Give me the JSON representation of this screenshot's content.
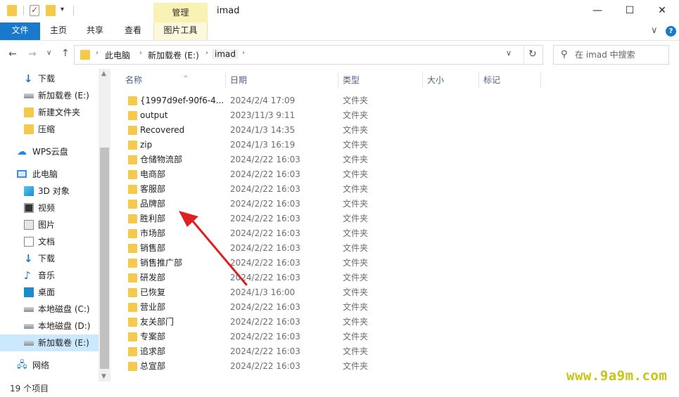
{
  "titlebar": {
    "manage_tab": "管理",
    "window_title": "imad",
    "minimize": "—",
    "maximize": "☐",
    "close": "✕"
  },
  "ribbon": {
    "tabs": [
      "文件",
      "主页",
      "共享",
      "查看",
      "图片工具"
    ],
    "expand": "∨",
    "help": "?"
  },
  "address": {
    "crumbs": [
      "此电脑",
      "新加载卷 (E:)",
      "imad"
    ],
    "search_placeholder": "在 imad 中搜索"
  },
  "sidebar": {
    "items": [
      {
        "label": "下载",
        "icon": "download-icon"
      },
      {
        "label": "新加载卷 (E:)",
        "icon": "drive-icon"
      },
      {
        "label": "新建文件夹",
        "icon": "folder-icon"
      },
      {
        "label": "压缩",
        "icon": "folder-icon"
      },
      {
        "label": "WPS云盘",
        "icon": "cloud-icon"
      },
      {
        "label": "此电脑",
        "icon": "computer-icon"
      },
      {
        "label": "3D 对象",
        "icon": "3d-objects-icon"
      },
      {
        "label": "视频",
        "icon": "video-icon"
      },
      {
        "label": "图片",
        "icon": "picture-icon"
      },
      {
        "label": "文档",
        "icon": "document-icon"
      },
      {
        "label": "下载",
        "icon": "download-icon"
      },
      {
        "label": "音乐",
        "icon": "music-icon"
      },
      {
        "label": "桌面",
        "icon": "desktop-icon"
      },
      {
        "label": "本地磁盘 (C:)",
        "icon": "system-drive-icon"
      },
      {
        "label": "本地磁盘 (D:)",
        "icon": "drive-icon"
      },
      {
        "label": "新加载卷 (E:)",
        "icon": "drive-icon"
      },
      {
        "label": "网络",
        "icon": "network-icon"
      }
    ]
  },
  "columns": {
    "name": "名称",
    "date": "日期",
    "type": "类型",
    "size": "大小",
    "tags": "标记"
  },
  "files": [
    {
      "name": "{1997d9ef-90f6-4...",
      "date": "2024/2/4 17:09",
      "type": "文件夹"
    },
    {
      "name": "output",
      "date": "2023/11/3 9:11",
      "type": "文件夹"
    },
    {
      "name": "Recovered",
      "date": "2024/1/3 14:35",
      "type": "文件夹"
    },
    {
      "name": "zip",
      "date": "2024/1/3 16:19",
      "type": "文件夹"
    },
    {
      "name": "仓储物流部",
      "date": "2024/2/22 16:03",
      "type": "文件夹"
    },
    {
      "name": "电商部",
      "date": "2024/2/22 16:03",
      "type": "文件夹"
    },
    {
      "name": "客服部",
      "date": "2024/2/22 16:03",
      "type": "文件夹"
    },
    {
      "name": "品牌部",
      "date": "2024/2/22 16:03",
      "type": "文件夹"
    },
    {
      "name": "胜利部",
      "date": "2024/2/22 16:03",
      "type": "文件夹"
    },
    {
      "name": "市场部",
      "date": "2024/2/22 16:03",
      "type": "文件夹"
    },
    {
      "name": "销售部",
      "date": "2024/2/22 16:03",
      "type": "文件夹"
    },
    {
      "name": "销售推广部",
      "date": "2024/2/22 16:03",
      "type": "文件夹"
    },
    {
      "name": "研发部",
      "date": "2024/2/22 16:03",
      "type": "文件夹"
    },
    {
      "name": "已恢复",
      "date": "2024/1/3 16:00",
      "type": "文件夹"
    },
    {
      "name": "营业部",
      "date": "2024/2/22 16:03",
      "type": "文件夹"
    },
    {
      "name": "友关部门",
      "date": "2024/2/22 16:03",
      "type": "文件夹"
    },
    {
      "name": "专案部",
      "date": "2024/2/22 16:03",
      "type": "文件夹"
    },
    {
      "name": "追求部",
      "date": "2024/2/22 16:03",
      "type": "文件夹"
    },
    {
      "name": "总宣部",
      "date": "2024/2/22 16:03",
      "type": "文件夹"
    }
  ],
  "status": {
    "item_count": "19 个项目"
  },
  "watermark": "www.9a9m.com",
  "colors": {
    "accent": "#1979ca",
    "folder": "#f5c94b",
    "manage_tab": "#f9f2b4",
    "selected": "#cce8ff",
    "annotation_arrow": "#e02020"
  }
}
